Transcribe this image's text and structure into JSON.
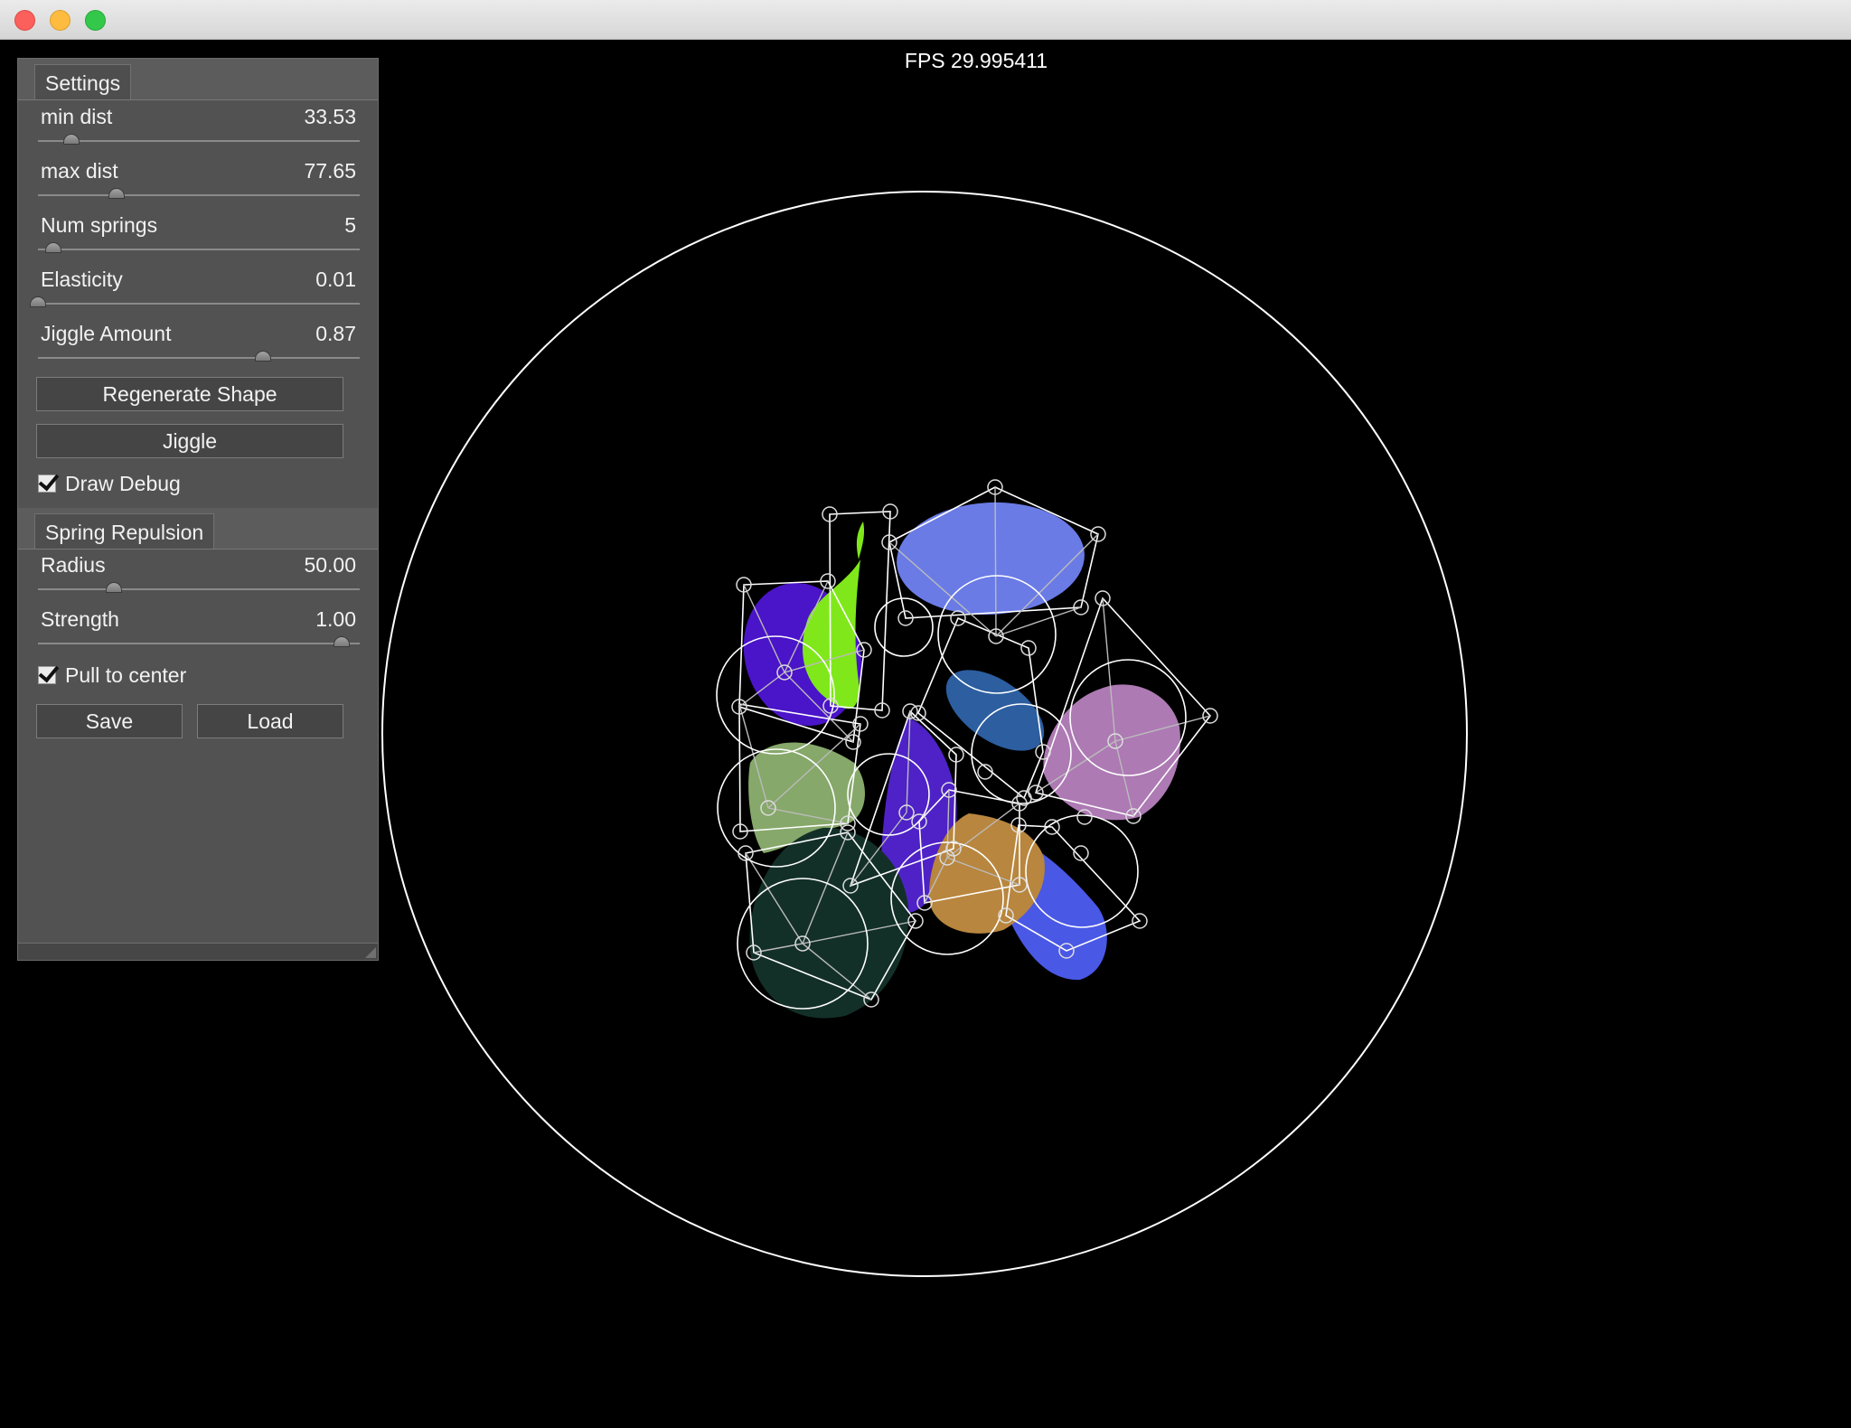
{
  "window": {
    "controls": [
      "close",
      "minimize",
      "zoom"
    ]
  },
  "overlay": {
    "fps": "FPS 29.995411"
  },
  "panel": {
    "settings": {
      "tab_label": "Settings",
      "sliders": [
        {
          "label": "min dist",
          "value": "33.53",
          "fraction": 0.11
        },
        {
          "label": "max dist",
          "value": "77.65",
          "fraction": 0.26
        },
        {
          "label": "Num springs",
          "value": "5",
          "fraction": 0.05
        },
        {
          "label": "Elasticity",
          "value": "0.01",
          "fraction": 0.0
        },
        {
          "label": "Jiggle Amount",
          "value": "0.87",
          "fraction": 0.74
        }
      ],
      "regenerate_label": "Regenerate Shape",
      "jiggle_label": "Jiggle",
      "draw_debug": {
        "label": "Draw Debug",
        "checked": true
      }
    },
    "spring_repulsion": {
      "tab_label": "Spring Repulsion",
      "sliders": [
        {
          "label": "Radius",
          "value": "50.00",
          "fraction": 0.25
        },
        {
          "label": "Strength",
          "value": "1.00",
          "fraction": 1.0
        }
      ],
      "pull_to_center": {
        "label": "Pull to center",
        "checked": true
      },
      "save_label": "Save",
      "load_label": "Load"
    }
  },
  "colors": {
    "blob_periwinkle": "#6a7be6",
    "blob_indigo": "#4a14c8",
    "blob_lime": "#80e81a",
    "blob_steel": "#2c5ea0",
    "blob_mauve": "#ad7ab4",
    "blob_sage": "#86a86a",
    "blob_violet": "#4e22c6",
    "blob_ochre": "#b8863e",
    "blob_royal": "#4a58e6",
    "blob_darkgreen": "#133028"
  }
}
